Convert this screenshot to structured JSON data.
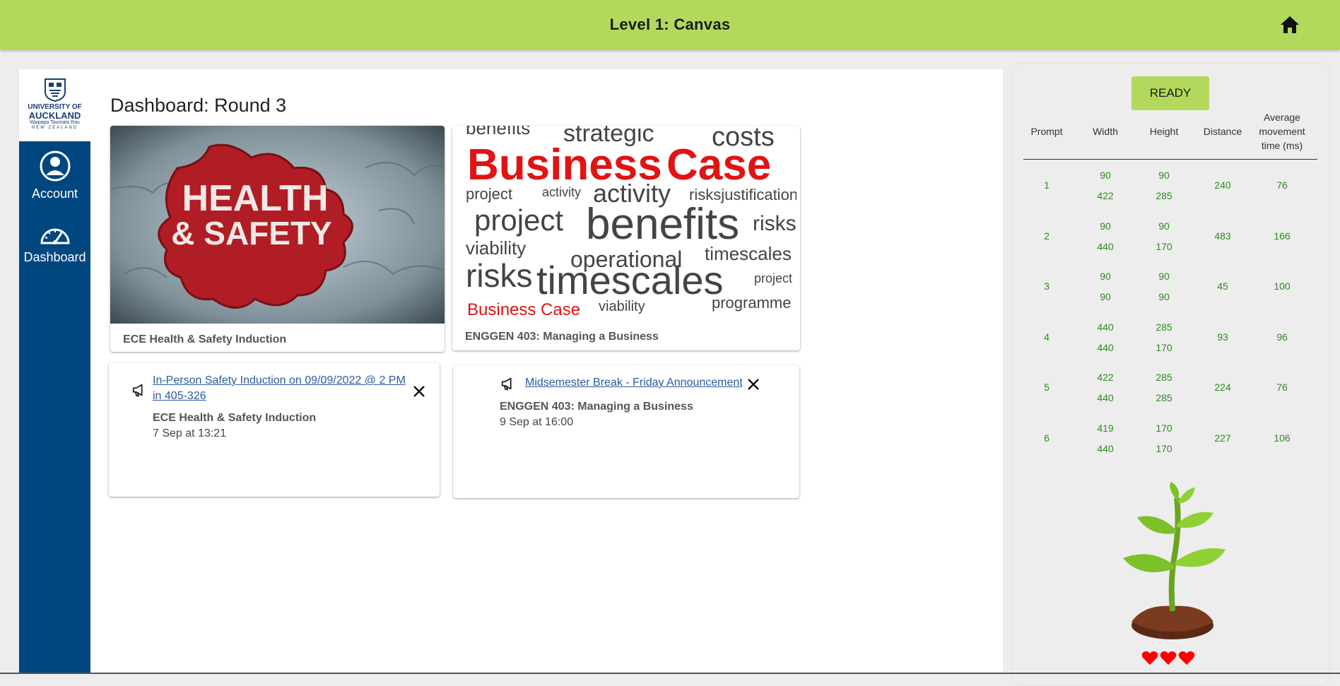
{
  "header": {
    "title": "Level 1: Canvas",
    "home_icon": "home-icon"
  },
  "logo": {
    "line1": "UNIVERSITY OF",
    "line2": "AUCKLAND",
    "line3": "Waipapa Taumata Rau",
    "line4": "NEW ZEALAND"
  },
  "sidebar": {
    "items": [
      {
        "label": "Account",
        "icon": "account-icon"
      },
      {
        "label": "Dashboard",
        "icon": "dashboard-icon"
      }
    ]
  },
  "dashboard": {
    "title": "Dashboard: Round 3",
    "courses": [
      {
        "name": "ECE Health & Safety Induction",
        "image_text": "HEALTH & SAFETY"
      },
      {
        "name": "ENGGEN 403: Managing a Business",
        "image_text": "Business Case"
      }
    ],
    "announcements": [
      {
        "title_line1": "In-Person Safety Induction on 09/09/2022 @ 2 PM",
        "title_line2": "in 405-326",
        "course": "ECE Health & Safety Induction",
        "time": "7 Sep at 13:21"
      },
      {
        "title_line1": "Midsemester Break - Friday Announcement",
        "course": "ENGGEN 403: Managing a Business",
        "time": "9 Sep at 16:00"
      }
    ]
  },
  "panel": {
    "ready_label": "READY",
    "columns": [
      "Prompt",
      "Width",
      "Height",
      "Distance",
      "Average movement time (ms)"
    ],
    "rows": [
      {
        "prompt": "1",
        "width": [
          "90",
          "422"
        ],
        "height": [
          "90",
          "285"
        ],
        "distance": "240",
        "time": "76"
      },
      {
        "prompt": "2",
        "width": [
          "90",
          "440"
        ],
        "height": [
          "90",
          "170"
        ],
        "distance": "483",
        "time": "166"
      },
      {
        "prompt": "3",
        "width": [
          "90",
          "90"
        ],
        "height": [
          "90",
          "90"
        ],
        "distance": "45",
        "time": "100"
      },
      {
        "prompt": "4",
        "width": [
          "440",
          "440"
        ],
        "height": [
          "285",
          "170"
        ],
        "distance": "93",
        "time": "96"
      },
      {
        "prompt": "5",
        "width": [
          "422",
          "440"
        ],
        "height": [
          "285",
          "285"
        ],
        "distance": "224",
        "time": "76"
      },
      {
        "prompt": "6",
        "width": [
          "419",
          "440"
        ],
        "height": [
          "170",
          "170"
        ],
        "distance": "227",
        "time": "106"
      }
    ],
    "lives": 3,
    "colors": {
      "accent": "#b3d95c",
      "nav": "#00467f",
      "table_value": "#2e8b1f",
      "heart": "#ff0000"
    }
  }
}
